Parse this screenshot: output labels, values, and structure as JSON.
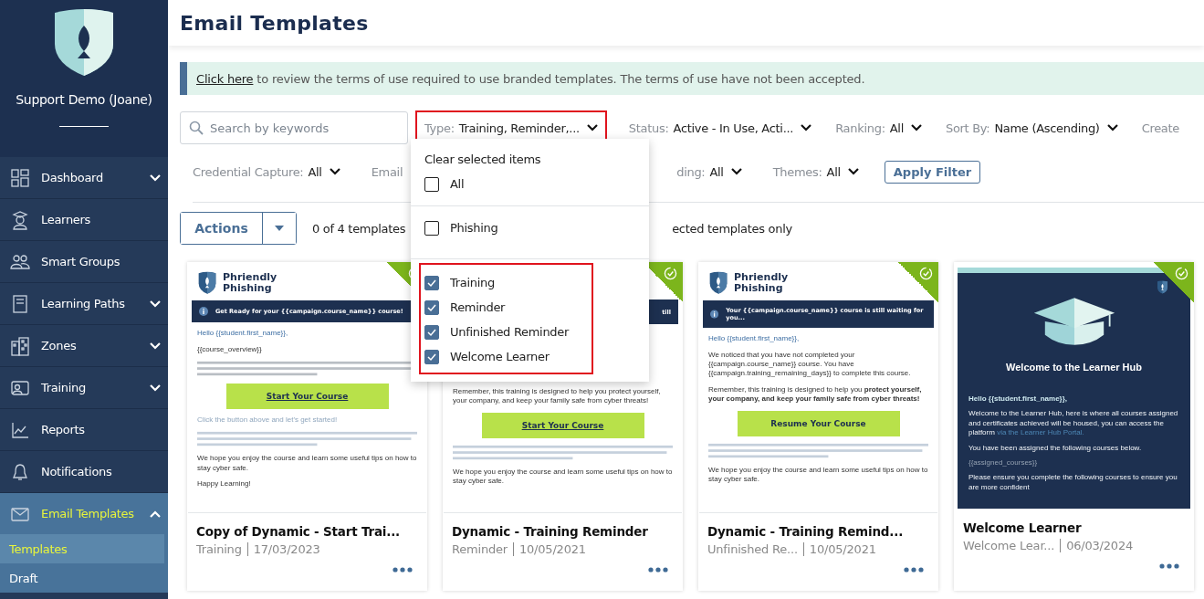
{
  "sidebar": {
    "org_name": "Support Demo (Joane)",
    "items": [
      {
        "label": "Dashboard",
        "expandable": true,
        "expanded": false,
        "selected": false
      },
      {
        "label": "Learners",
        "expandable": false,
        "selected": false
      },
      {
        "label": "Smart Groups",
        "expandable": false,
        "selected": false
      },
      {
        "label": "Learning Paths",
        "expandable": true,
        "expanded": false,
        "selected": false
      },
      {
        "label": "Zones",
        "expandable": true,
        "expanded": false,
        "selected": false
      },
      {
        "label": "Training",
        "expandable": true,
        "expanded": false,
        "selected": false
      },
      {
        "label": "Reports",
        "expandable": false,
        "selected": false
      },
      {
        "label": "Notifications",
        "expandable": false,
        "selected": false
      },
      {
        "label": "Email Templates",
        "expandable": true,
        "expanded": true,
        "selected": true,
        "children": [
          {
            "label": "Templates",
            "selected": true
          },
          {
            "label": "Draft",
            "selected": false
          }
        ]
      }
    ]
  },
  "header": {
    "title": "Email Templates"
  },
  "notice": {
    "link": "Click here",
    "text": "to review the terms of use required to use branded templates. The terms of use have not been accepted."
  },
  "search": {
    "placeholder": "Search by keywords"
  },
  "filter_row_1": [
    {
      "label": "Type:",
      "value": "Training, Reminder,...",
      "highlighted": true
    },
    {
      "label": "Status:",
      "value": "Active - In Use, Acti...",
      "highlighted": false
    },
    {
      "label": "Ranking:",
      "value": "All",
      "highlighted": false
    },
    {
      "label": "Sort By:",
      "value": "Name (Ascending)",
      "highlighted": false
    },
    {
      "label": "Create",
      "highlighted": false
    }
  ],
  "filter_row_2": [
    {
      "label": "Credential Capture:",
      "value": "All",
      "highlighted": false
    },
    {
      "label": "Email",
      "highlighted": false
    },
    {
      "label": "ding:",
      "value": "All",
      "highlighted": false
    },
    {
      "label": "Themes:",
      "value": "All",
      "highlighted": false
    }
  ],
  "apply_button": "Apply Filter",
  "actions_button": "Actions",
  "selection_texts": [
    "0 of 4 templates",
    "ected templates only"
  ],
  "type_dropdown": {
    "clear_label": "Clear selected items",
    "all_option": {
      "label": "All",
      "checked": false
    },
    "groups": [
      {
        "highlighted": false,
        "options": [
          {
            "label": "Phishing",
            "checked": false
          }
        ]
      },
      {
        "highlighted": true,
        "options": [
          {
            "label": "Training",
            "checked": true
          },
          {
            "label": "Reminder",
            "checked": true
          },
          {
            "label": "Unfinished Reminder",
            "checked": true
          },
          {
            "label": "Welcome Learner",
            "checked": true
          }
        ]
      }
    ]
  },
  "templates": [
    {
      "title": "Copy of Dynamic - Start Trai...",
      "category": "Training",
      "date": "17/03/2023",
      "active": true,
      "preview": {
        "dark": false,
        "blocks": [
          {
            "kind": "brand",
            "top": "Phriendly",
            "bottom": "Phishing"
          },
          {
            "kind": "banner",
            "text": "Get Ready for your {{campaign.course_name}} course!"
          },
          {
            "kind": "greeting",
            "text": "Hello {{student.first_name}},"
          },
          {
            "kind": "paragraph",
            "text": "{{course_overview}}"
          },
          {
            "kind": "lines"
          },
          {
            "kind": "cta",
            "text": "Start Your Course",
            "underlined": true
          },
          {
            "kind": "note",
            "text": "Click the button above and let's get started!"
          },
          {
            "kind": "note_lines"
          },
          {
            "kind": "paragraph",
            "text": "We hope you enjoy the course and learn some useful tips on how to stay cyber safe."
          },
          {
            "kind": "paragraph",
            "text": "Happy Learning!"
          }
        ]
      }
    },
    {
      "title": "Dynamic - Training Reminder",
      "category": "Reminder",
      "date": "10/05/2021",
      "active": true,
      "preview": {
        "dark": false,
        "blocks": [
          {
            "kind": "blank"
          },
          {
            "kind": "banner_tail",
            "text": "till"
          },
          {
            "kind": "blank"
          },
          {
            "kind": "blank"
          },
          {
            "kind": "paragraph",
            "text": "Remember, this training is designed to help you protect yourself, your company, and keep your family safe from cyber threats!"
          },
          {
            "kind": "cta",
            "text": "Start Your Course",
            "underlined": true
          },
          {
            "kind": "note_lines"
          },
          {
            "kind": "paragraph",
            "text": "We hope you enjoy the course and learn some useful tips on how to stay cyber safe."
          }
        ]
      }
    },
    {
      "title": "Dynamic - Training Remind...",
      "category": "Unfinished Re...",
      "date": "10/05/2021",
      "active": true,
      "preview": {
        "dark": false,
        "blocks": [
          {
            "kind": "brand",
            "top": "Phriendly",
            "bottom": "Phishing"
          },
          {
            "kind": "banner",
            "text": "Your {{campaign.course_name}} course is still waiting for you..."
          },
          {
            "kind": "greeting",
            "text": "Hello {{student.first_name}},"
          },
          {
            "kind": "paragraph",
            "text": "We noticed that you have not completed your {{campaign.course_name}} course. You have {{campaign.training_remaining_days}} to complete this course."
          },
          {
            "kind": "paragraph",
            "text": "Remember, this training is designed to help you **protect yourself, your company, and keep your family safe from cyber threats!**"
          },
          {
            "kind": "cta",
            "text": "Resume Your Course",
            "underlined": false
          },
          {
            "kind": "note_lines"
          },
          {
            "kind": "paragraph",
            "text": "We hope you enjoy the course and learn some useful tips on how to stay cyber safe."
          }
        ]
      }
    },
    {
      "title": "Welcome Learner",
      "category": "Welcome Lear...",
      "date": "06/03/2024",
      "active": true,
      "preview": {
        "dark": true,
        "blocks": [
          {
            "kind": "corner_logo"
          },
          {
            "kind": "cap"
          },
          {
            "kind": "heading",
            "text": "Welcome to the Learner Hub"
          },
          {
            "kind": "greeting",
            "text": "Hello {{student.first_name}},"
          },
          {
            "kind": "paragraph",
            "text": "Welcome to the Learner Hub, here is where all courses assigned and certificates achieved will be housed, you can access the platform",
            "link": "via the Learner Hub Portal."
          },
          {
            "kind": "paragraph",
            "text": "You have been assigned the following courses below."
          },
          {
            "kind": "note",
            "text": "{{assigned_courses}}"
          },
          {
            "kind": "paragraph",
            "text": "Please ensure you complete the following courses to ensure you are more confident"
          }
        ]
      }
    }
  ]
}
